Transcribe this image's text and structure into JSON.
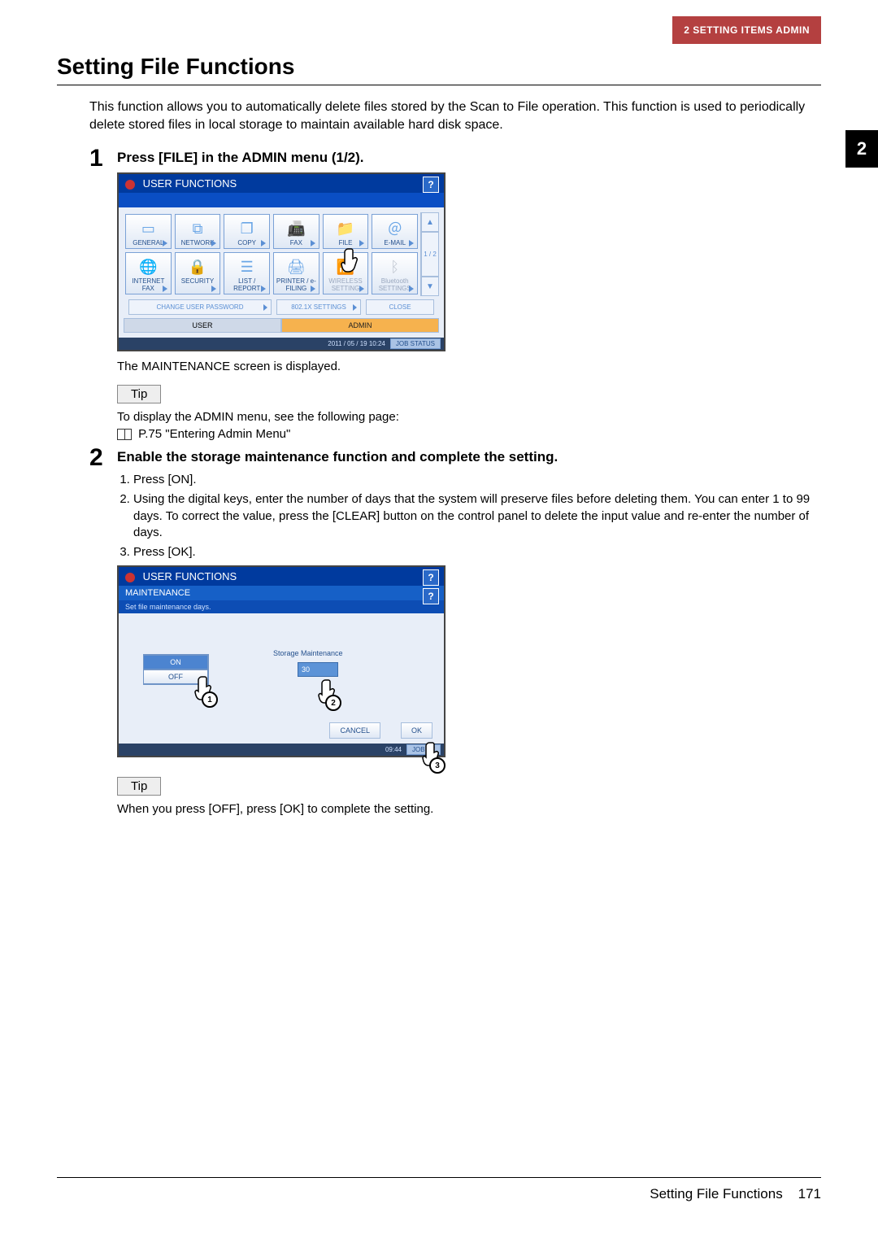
{
  "header": {
    "section_label": "2 SETTING ITEMS ADMIN"
  },
  "side_tab": "2",
  "title": "Setting File Functions",
  "intro": "This function allows you to automatically delete files stored by the Scan to File operation. This function is used to periodically delete stored files in local storage to maintain available hard disk space.",
  "steps": {
    "s1": {
      "num": "1",
      "title": "Press [FILE] in the ADMIN menu (1/2).",
      "result": "The MAINTENANCE screen is displayed.",
      "tip_label": "Tip",
      "tip_line1": "To display the ADMIN menu, see the following page:",
      "tip_ref": "P.75 \"Entering Admin Menu\""
    },
    "s2": {
      "num": "2",
      "title": "Enable the storage maintenance function and complete the setting.",
      "items": {
        "i1": "Press [ON].",
        "i2": "Using the digital keys, enter the number of days that the system will preserve files before deleting them. You can enter 1 to 99 days. To correct the value, press the [CLEAR] button on the control panel to delete the input value and re-enter the number of days.",
        "i3": "Press [OK]."
      },
      "tip_label": "Tip",
      "tip_text": "When you press [OFF], press [OK] to complete the setting."
    }
  },
  "screen1": {
    "title": "USER FUNCTIONS",
    "help": "?",
    "tiles": {
      "general": "GENERAL",
      "network": "NETWORK",
      "copy": "COPY",
      "fax": "FAX",
      "file": "FILE",
      "email": "E-MAIL",
      "ifax": "INTERNET FAX",
      "security": "SECURITY",
      "list": "LIST / REPORT",
      "printer": "PRINTER / e-FILING",
      "wireless": "WIRELESS SETTING",
      "bt": "Bluetooth SETTINGS"
    },
    "page_indicator": "1 / 2",
    "btn_change_pw": "CHANGE USER PASSWORD",
    "btn_8021x": "802.1X SETTINGS",
    "btn_close": "CLOSE",
    "tab_user": "USER",
    "tab_admin": "ADMIN",
    "timestamp": "2011 / 05 / 19  10:24",
    "job_status": "JOB STATUS"
  },
  "screen2": {
    "title": "USER FUNCTIONS",
    "submenu": "MAINTENANCE",
    "instr": "Set file maintenance days.",
    "help": "?",
    "on": "ON",
    "off": "OFF",
    "field_label": "Storage Maintenance",
    "value": "30",
    "cancel": "CANCEL",
    "ok": "OK",
    "timestamp": "09:44",
    "job_status": "JOB ST"
  },
  "footer": {
    "title": "Setting File Functions",
    "page": "171"
  }
}
